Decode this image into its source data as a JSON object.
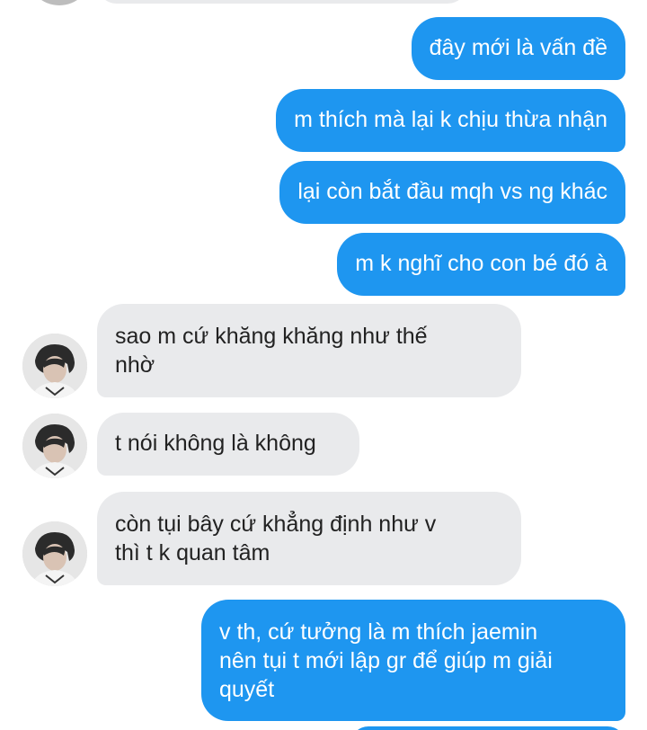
{
  "messages": [
    {
      "id": "m1",
      "direction": "outgoing",
      "text": "đây mới là vấn đề"
    },
    {
      "id": "m2",
      "direction": "outgoing",
      "text": "m thích mà lại k chịu thừa nhận"
    },
    {
      "id": "m3",
      "direction": "outgoing",
      "text": "lại còn bắt đầu mqh vs ng khác"
    },
    {
      "id": "m4",
      "direction": "outgoing",
      "text": "m k nghĩ cho con bé đó à"
    },
    {
      "id": "m5",
      "direction": "incoming",
      "lines": [
        "sao m cứ khăng khăng như thế",
        "nhờ"
      ]
    },
    {
      "id": "m6",
      "direction": "incoming",
      "text": "t nói không là không"
    },
    {
      "id": "m7",
      "direction": "incoming",
      "lines": [
        "còn tụi bây cứ khẳng định như v",
        "thì t k quan tâm"
      ]
    },
    {
      "id": "m8",
      "direction": "outgoing",
      "lines": [
        "v th, cứ tưởng là m thích jaemin",
        "nên tụi t mới lập gr để giúp m giải",
        "quyết"
      ]
    }
  ],
  "colors": {
    "outgoing_bubble": "#1e96f0",
    "incoming_bubble": "#e9eaec",
    "outgoing_text": "#ffffff",
    "incoming_text": "#222222"
  },
  "icons": {
    "contact_avatar": "avatar-photo"
  }
}
